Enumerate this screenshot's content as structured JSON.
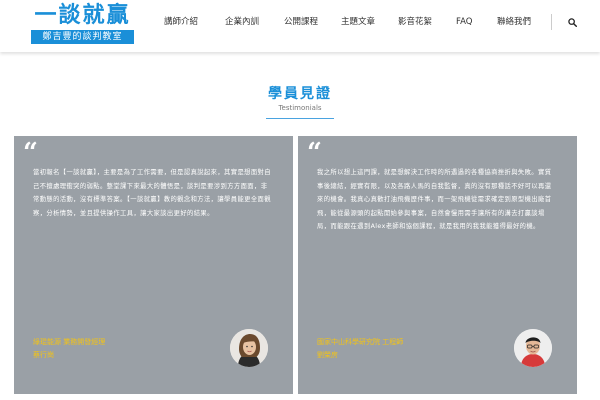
{
  "logo": {
    "title": "一談就贏",
    "subtitle": "鄭吉豐的談判教室"
  },
  "nav": {
    "items": [
      {
        "label": "講師介紹"
      },
      {
        "label": "企業內訓"
      },
      {
        "label": "公開課程"
      },
      {
        "label": "主題文章"
      },
      {
        "label": "影音花絮"
      },
      {
        "label": "FAQ"
      },
      {
        "label": "聯絡我們"
      }
    ],
    "search_icon": "search-icon"
  },
  "section": {
    "title": "學員見證",
    "subtitle": "Testimonials"
  },
  "testimonials": [
    {
      "quote_icon": "quote-icon",
      "text": "當初報名【一談就贏】，主要是為了工作需要，但是認真說起來，其實是想面對自己不擅處理衝突的弱點。整堂課下來最大的體悟是，談判是要涉到方方面面，非常動態的活動，沒有標準答案。【一談就贏】教的觀念和方法，讓學員能更全面觀察，分析情勢，並且提供操作工具，讓大家談出更好的結果。",
      "company": "綠琨能源 業務開發經理",
      "name": "蔡行崗",
      "avatar": "avatar-woman"
    },
    {
      "quote_icon": "quote-icon",
      "text": "我之所以想上這門課，就是想解決工作時的所遇過的各種協商挫折與失敗。實質事後總結，經實有限，以及各路人馬的自我監督，真的沒有那種話不好可以再還來的機會。我真心真歡打油飛機歷件事，而一架飛機從需求確定到原型機出廠首飛，能從最源頭的起點開始參與事案，自然會慢用需手讓所有的溝去打贏談場局，而能跟在遇到Alex老師和協個課程，就是我用的我我能獲得最好的機。",
      "company": "國家中山科學研究院 工程師",
      "name": "劉榮房",
      "avatar": "avatar-man"
    }
  ],
  "colors": {
    "brand_blue": "#1a8fd8",
    "card_gray": "#9aa0a6",
    "name_yellow": "#f3c316"
  }
}
